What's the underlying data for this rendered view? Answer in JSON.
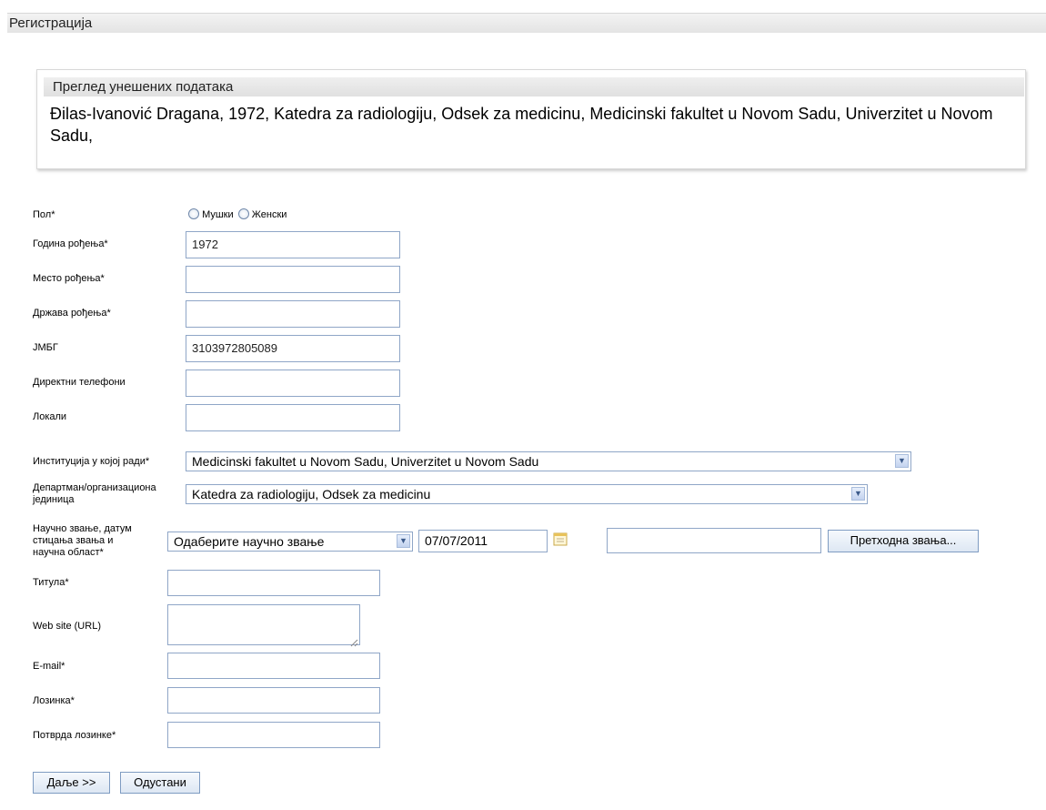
{
  "header": {
    "title": "Регистрација"
  },
  "review": {
    "title": "Преглед унешених података",
    "text": "Đilas-Ivanović Dragana, 1972, Katedra za radiologiju, Odsek za medicinu, Medicinski fakultet u Novom Sadu, Univerzitet u Novom Sadu,"
  },
  "form": {
    "gender": {
      "label": "Пол*",
      "option_male": "Мушки",
      "option_female": "Женски"
    },
    "birth_year": {
      "label": "Година рођења*",
      "value": "1972"
    },
    "birth_place": {
      "label": "Место рођења*",
      "value": ""
    },
    "birth_country": {
      "label": "Држава рођења*",
      "value": ""
    },
    "jmbg": {
      "label": "ЈМБГ",
      "value": "3103972805089"
    },
    "direct_phones": {
      "label": "Директни телефони",
      "value": ""
    },
    "locals": {
      "label": "Локали",
      "value": ""
    },
    "institution": {
      "label": "Институција у којој ради*",
      "value": "Medicinski fakultet u Novom Sadu, Univerzitet u Novom Sadu"
    },
    "department": {
      "label_line1": "Департман/организациона",
      "label_line2": "јединица",
      "value": "Katedra za radiologiju, Odsek za medicinu"
    },
    "sci_title": {
      "label_line1": "Научно звање, датум",
      "label_line2": "стицања звања и",
      "label_line3": "научна област*",
      "select_value": "Одаберите научно звање",
      "date_value": "07/07/2011",
      "field_value": "",
      "previous_button": "Претходна звања..."
    },
    "title": {
      "label": "Титула*",
      "value": ""
    },
    "website": {
      "label": "Web site (URL)",
      "value": ""
    },
    "email": {
      "label": "E-mail*",
      "value": ""
    },
    "password": {
      "label": "Лозинка*",
      "value": ""
    },
    "password_confirm": {
      "label": "Потврда лозинке*",
      "value": ""
    }
  },
  "actions": {
    "next_label": "Даље >>",
    "cancel_label": "Одустани"
  }
}
